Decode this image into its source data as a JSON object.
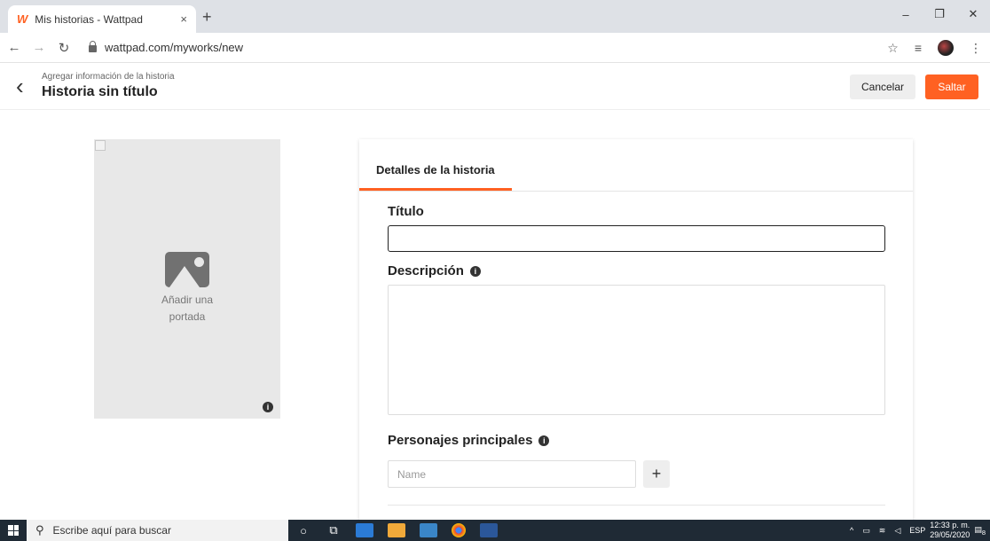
{
  "browser": {
    "tab_title": "Mis historias - Wattpad",
    "tab_favicon": "W",
    "tab_close": "×",
    "new_tab": "+",
    "url": "wattpad.com/myworks/new"
  },
  "header": {
    "back_icon": "‹",
    "subtitle": "Agregar información de la historia",
    "title": "Historia sin título",
    "cancel_label": "Cancelar",
    "skip_label": "Saltar"
  },
  "cover": {
    "add_label_line1": "Añadir una",
    "add_label_line2": "portada"
  },
  "form": {
    "tab_label": "Detalles de la historia",
    "title_label": "Título",
    "title_value": "",
    "description_label": "Descripción",
    "description_value": "",
    "characters_label": "Personajes principales",
    "name_placeholder": "Name",
    "add_label": "+"
  },
  "taskbar": {
    "search_placeholder": "Escribe aquí para buscar",
    "language": "ESP",
    "time": "12:33 p. m.",
    "date": "29/05/2020",
    "notifications": "8"
  },
  "colors": {
    "accent": "#ff6122",
    "taskbar": "#1f2a35"
  }
}
